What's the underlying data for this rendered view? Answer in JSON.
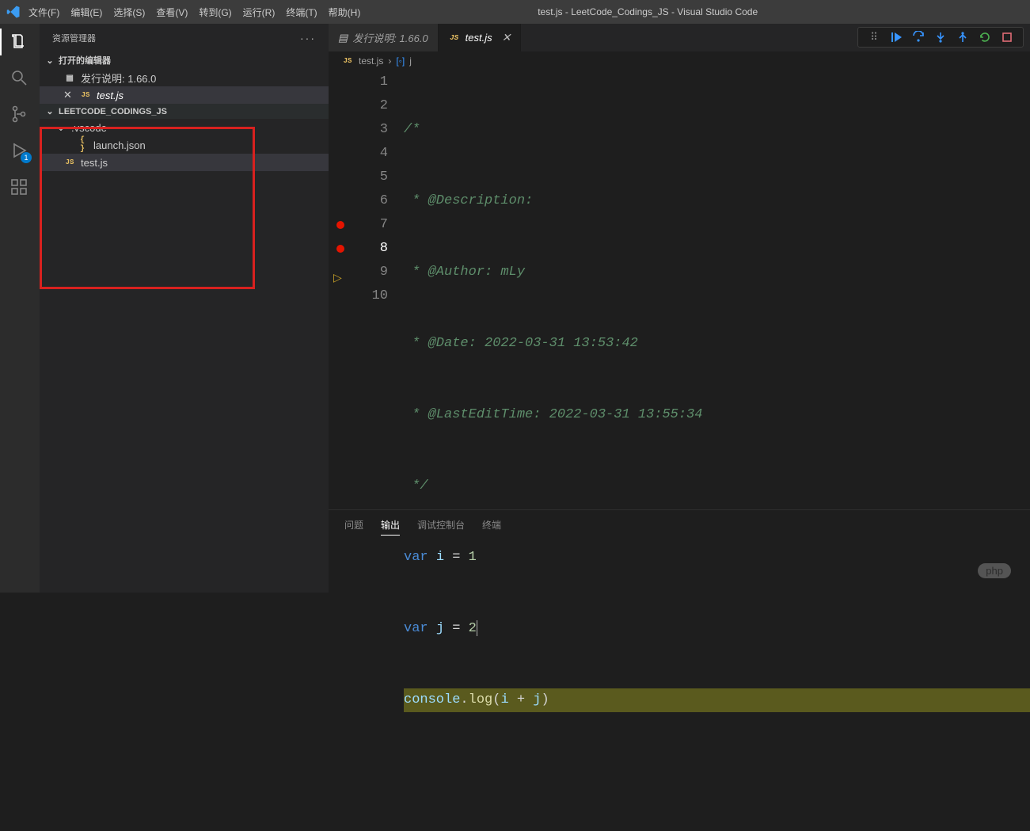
{
  "window": {
    "title": "test.js - LeetCode_Codings_JS - Visual Studio Code"
  },
  "menu": {
    "file": "文件(F)",
    "edit": "编辑(E)",
    "select": "选择(S)",
    "view": "查看(V)",
    "go": "转到(G)",
    "run": "运行(R)",
    "terminal": "终端(T)",
    "help": "帮助(H)"
  },
  "activity": {
    "debug_badge": "1"
  },
  "sidebar": {
    "title": "资源管理器",
    "open_editors": "打开的编辑器",
    "release_notes": "发行说明: 1.66.0",
    "open_file": "test.js",
    "project": "LEETCODE_CODINGS_JS",
    "folder_vscode": ".vscode",
    "file_launch": "launch.json",
    "file_test": "test.js"
  },
  "tabs": {
    "release": "发行说明: 1.66.0",
    "test": "test.js"
  },
  "breadcrumb": {
    "file": "test.js",
    "symbol": "j"
  },
  "code": {
    "l1": "/*",
    "l2": " * @Description: ",
    "l3": " * @Author: mLy",
    "l4": " * @Date: 2022-03-31 13:53:42",
    "l5": " * @LastEditTime: 2022-03-31 13:55:34",
    "l6": " */",
    "l7_kw": "var",
    "l7_var": "i",
    "l7_eq": "=",
    "l7_num": "1",
    "l8_kw": "var",
    "l8_var": "j",
    "l8_eq": "=",
    "l8_num": "2",
    "l9_obj": "console",
    "l9_dot": ".",
    "l9_fn": "log",
    "l9_op_o": "(",
    "l9_arg_i": "i",
    "l9_plus": "+",
    "l9_arg_j": "j",
    "l9_op_c": ")"
  },
  "line_numbers": [
    "1",
    "2",
    "3",
    "4",
    "5",
    "6",
    "7",
    "8",
    "9",
    "10"
  ],
  "panel": {
    "problems": "问题",
    "output": "输出",
    "debug_console": "调试控制台",
    "terminal": "终端"
  },
  "watermark": "php"
}
